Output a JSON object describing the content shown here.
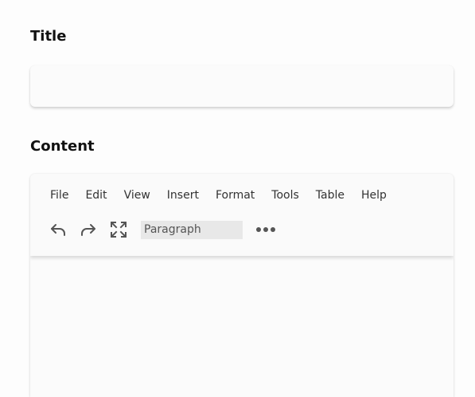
{
  "title_section": {
    "label": "Title",
    "input_value": "",
    "input_placeholder": ""
  },
  "content_section": {
    "label": "Content"
  },
  "editor": {
    "menu": [
      "File",
      "Edit",
      "View",
      "Insert",
      "Format",
      "Tools",
      "Table",
      "Help"
    ],
    "toolbar": {
      "undo_icon": "undo-icon",
      "redo_icon": "redo-icon",
      "fullscreen_icon": "fullscreen-icon",
      "block_format_value": "Paragraph",
      "more_icon": "more-icon"
    },
    "body_text": ""
  },
  "colors": {
    "background": "#fdfdfd",
    "label_text": "#111111",
    "menu_text": "#333333",
    "icon": "#555555",
    "select_background": "#e8e8e8"
  }
}
